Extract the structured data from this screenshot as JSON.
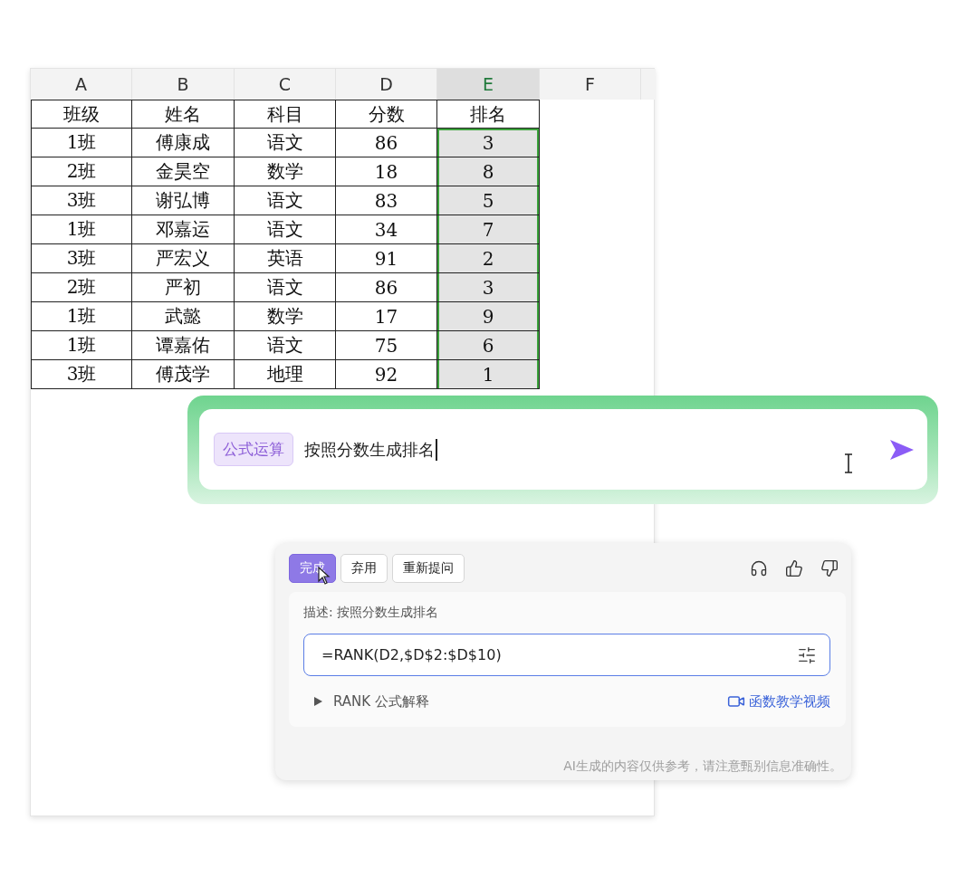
{
  "sheet": {
    "columns": [
      {
        "label": "A",
        "selected": false
      },
      {
        "label": "B",
        "selected": false
      },
      {
        "label": "C",
        "selected": false
      },
      {
        "label": "D",
        "selected": false
      },
      {
        "label": "E",
        "selected": true
      },
      {
        "label": "F",
        "selected": false
      }
    ],
    "rows": [
      {
        "selected": false,
        "cells": [
          "班级",
          "姓名",
          "科目",
          "分数",
          "排名"
        ]
      },
      {
        "selected": true,
        "cells": [
          "1班",
          "傅康成",
          "语文",
          "86",
          "3"
        ]
      },
      {
        "selected": true,
        "cells": [
          "2班",
          "金昊空",
          "数学",
          "18",
          "8"
        ]
      },
      {
        "selected": true,
        "cells": [
          "3班",
          "谢弘博",
          "语文",
          "83",
          "5"
        ]
      },
      {
        "selected": true,
        "cells": [
          "1班",
          "邓嘉运",
          "语文",
          "34",
          "7"
        ]
      },
      {
        "selected": true,
        "cells": [
          "3班",
          "严宏义",
          "英语",
          "91",
          "2"
        ]
      },
      {
        "selected": true,
        "cells": [
          "2班",
          "严初",
          "语文",
          "86",
          "3"
        ]
      },
      {
        "selected": true,
        "cells": [
          "1班",
          "武懿",
          "数学",
          "17",
          "9"
        ]
      },
      {
        "selected": true,
        "cells": [
          "1班",
          "谭嘉佑",
          "语文",
          "75",
          "6"
        ]
      },
      {
        "selected": true,
        "cells": [
          "3班",
          "傅茂学",
          "地理",
          "92",
          "1"
        ]
      }
    ]
  },
  "prompt": {
    "tag": "公式运算",
    "value": "按照分数生成排名"
  },
  "result": {
    "buttons": [
      {
        "label": "完成",
        "kind": "primary"
      },
      {
        "label": "弃用",
        "kind": "plain"
      },
      {
        "label": "重新提问",
        "kind": "plain"
      }
    ],
    "description": "描述: 按照分数生成排名",
    "formula": "=RANK(D2,$D$2:$D$10)",
    "explain": {
      "label": "RANK 公式解释",
      "expanded": false
    },
    "video_link": "函数教学视频",
    "disclaimer": "AI生成的内容仅供参考，请注意甄别信息准确性。"
  }
}
